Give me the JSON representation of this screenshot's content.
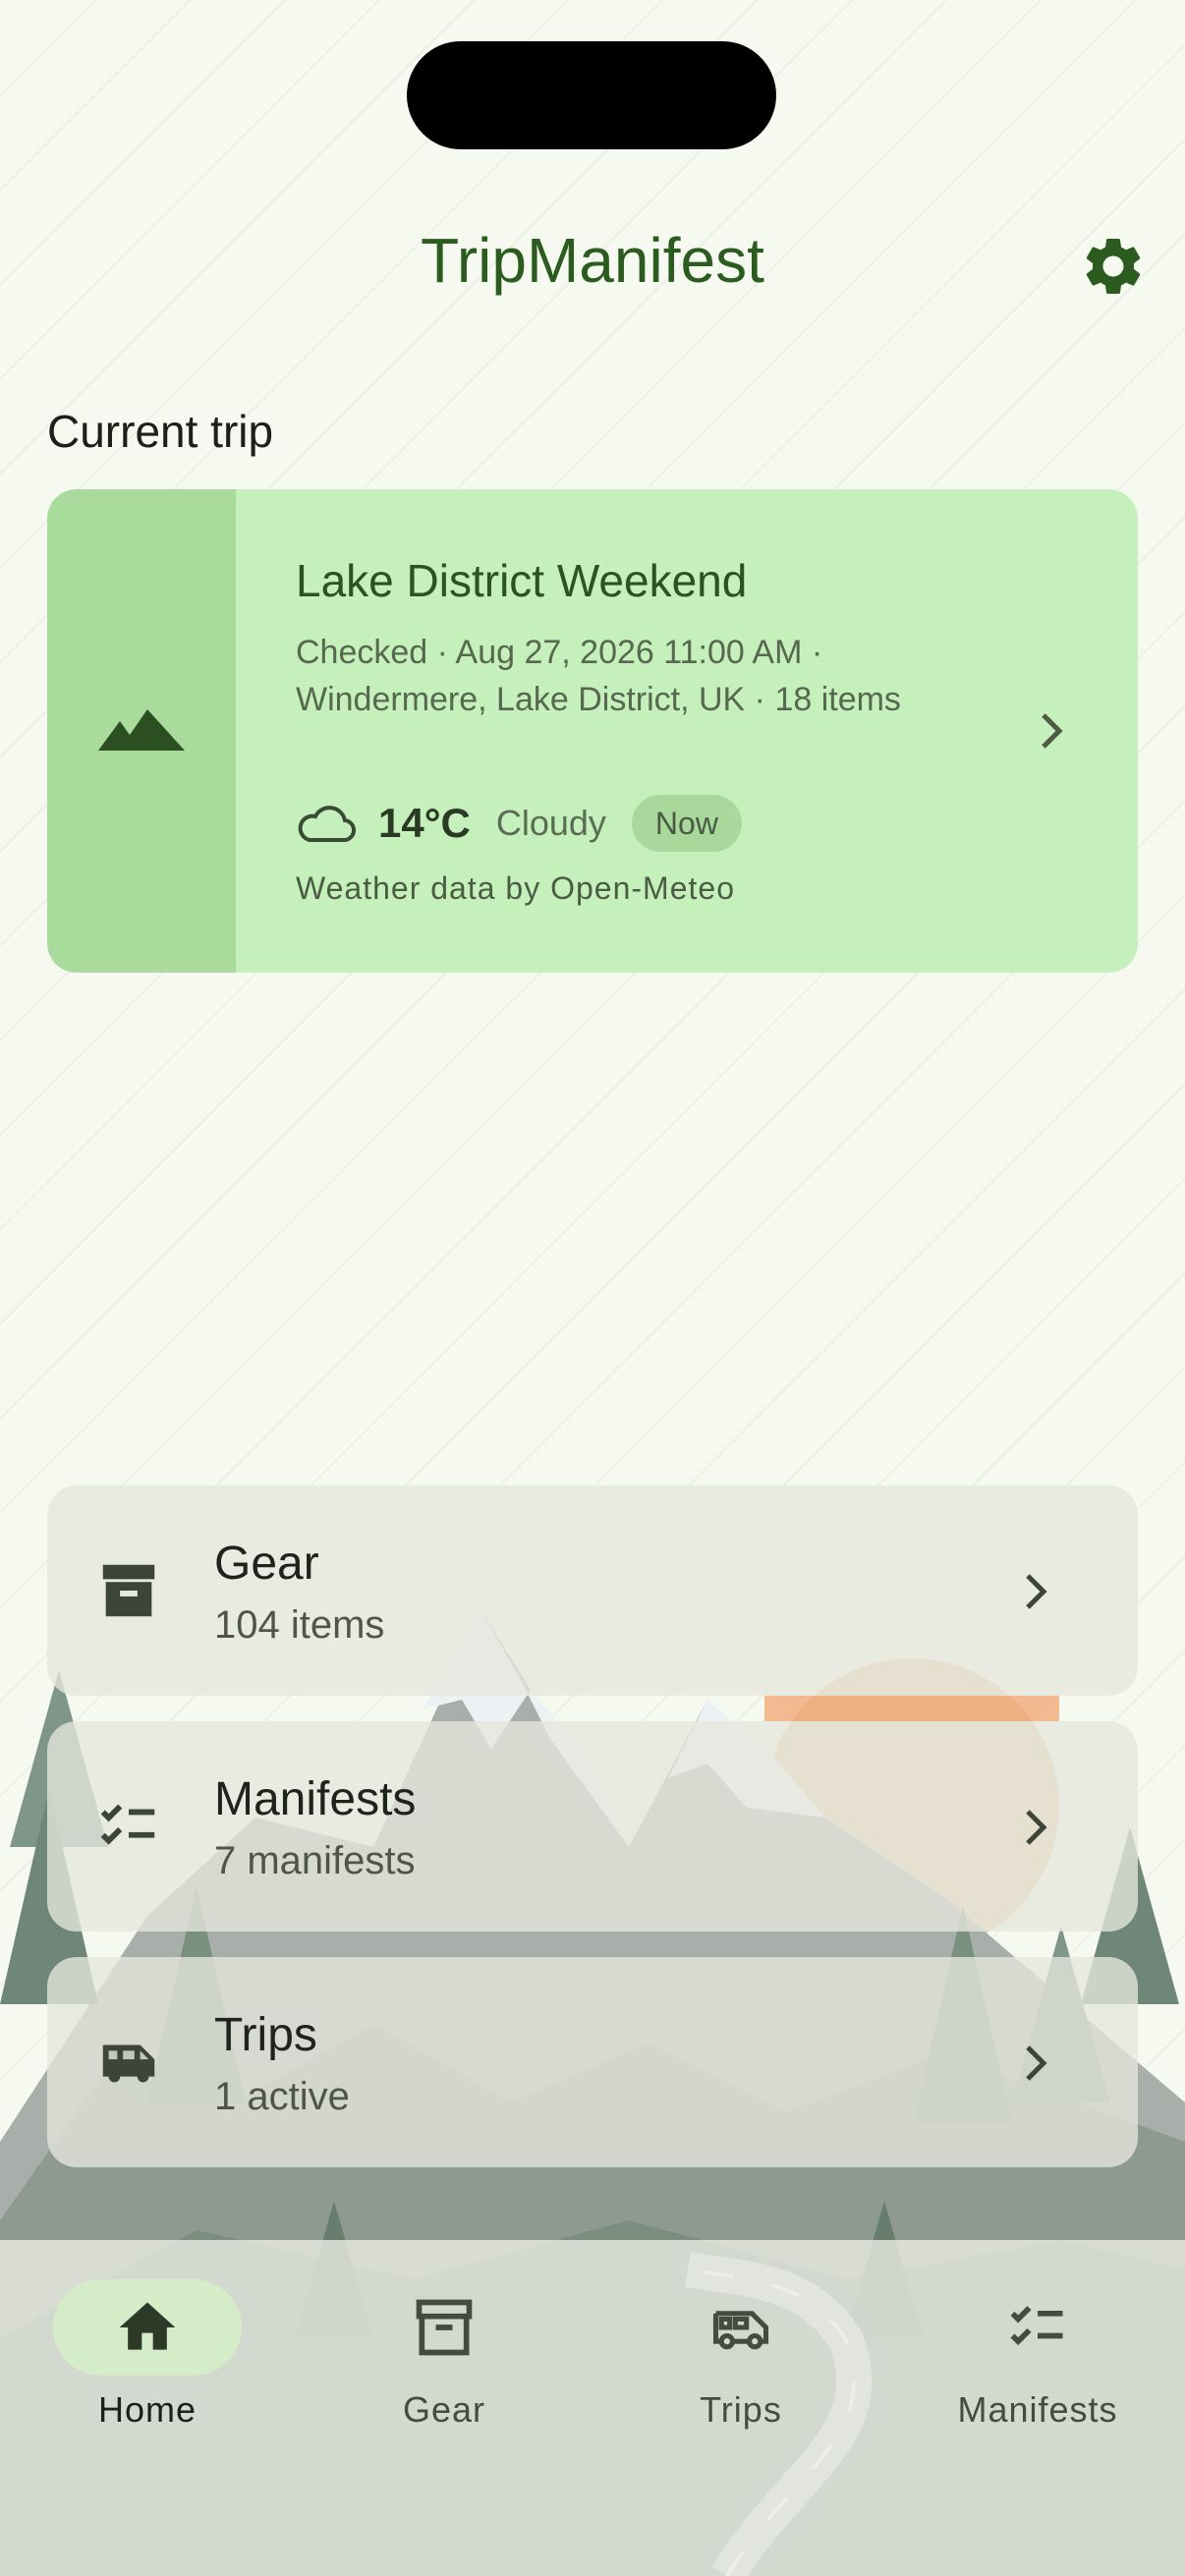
{
  "app": {
    "title": "TripManifest"
  },
  "current_trip": {
    "section_label": "Current trip",
    "name": "Lake District Weekend",
    "details": "Checked · Aug 27, 2026 11:00 AM · Windermere, Lake District, UK · 18 items",
    "weather": {
      "icon": "cloud-icon",
      "temperature": "14°C",
      "condition": "Cloudy",
      "badge": "Now",
      "attribution": "Weather data by Open-Meteo"
    },
    "card_icon": "mountain-icon"
  },
  "nav_cards": [
    {
      "icon": "archive-box-icon",
      "title": "Gear",
      "subtitle": "104 items"
    },
    {
      "icon": "checklist-icon",
      "title": "Manifests",
      "subtitle": "7 manifests"
    },
    {
      "icon": "van-icon",
      "title": "Trips",
      "subtitle": "1 active"
    }
  ],
  "bottom_nav": {
    "active": "Home",
    "tabs": [
      {
        "label": "Home",
        "icon": "home-icon"
      },
      {
        "label": "Gear",
        "icon": "archive-box-icon"
      },
      {
        "label": "Trips",
        "icon": "van-icon"
      },
      {
        "label": "Manifests",
        "icon": "checklist-icon"
      }
    ]
  },
  "colors": {
    "accent": "#2b5b1f",
    "card_bg": "#c6f0bb",
    "card_strip": "#a9dc9c",
    "page_bg": "#f6f9f0",
    "active_tab_pill": "#d5ecc8",
    "sun": "#e8c6a6"
  }
}
